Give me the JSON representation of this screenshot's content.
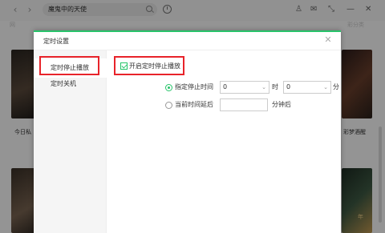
{
  "topbar": {
    "back_glyph": "‹",
    "forward_glyph": "›",
    "search_value": "魔鬼中的天使",
    "icons": [
      "shirt-icon",
      "mail-icon",
      "minimize-to-tray-icon",
      "minimize-icon",
      "close-icon"
    ],
    "shirt_glyph": "♙",
    "mail_glyph": "✉",
    "tray_glyph": "⤡",
    "min_glyph": "—",
    "close_glyph": "✕"
  },
  "background": {
    "side_partial": "网",
    "right_partial": "彩分类",
    "card1_caption": "今日私",
    "card2_caption": "彩梦酒醒",
    "card_bottom_right_text": "年"
  },
  "dialog": {
    "title": "定时设置",
    "close_glyph": "✕",
    "sidebar": [
      {
        "label": "定时停止播放",
        "active": true
      },
      {
        "label": "定时关机",
        "active": false
      }
    ],
    "enable_label": "开启定时停止播放",
    "enable_checked": true,
    "option_specific": {
      "label": "指定停止时间",
      "selected": true,
      "hour_value": "0",
      "hour_unit": "时",
      "minute_value": "0",
      "minute_unit": "分"
    },
    "option_delay": {
      "label": "当前时间延后",
      "selected": false,
      "minutes_value": "",
      "unit": "分钟后"
    }
  },
  "colors": {
    "accent": "#27c46a",
    "highlight": "#e8232a"
  }
}
